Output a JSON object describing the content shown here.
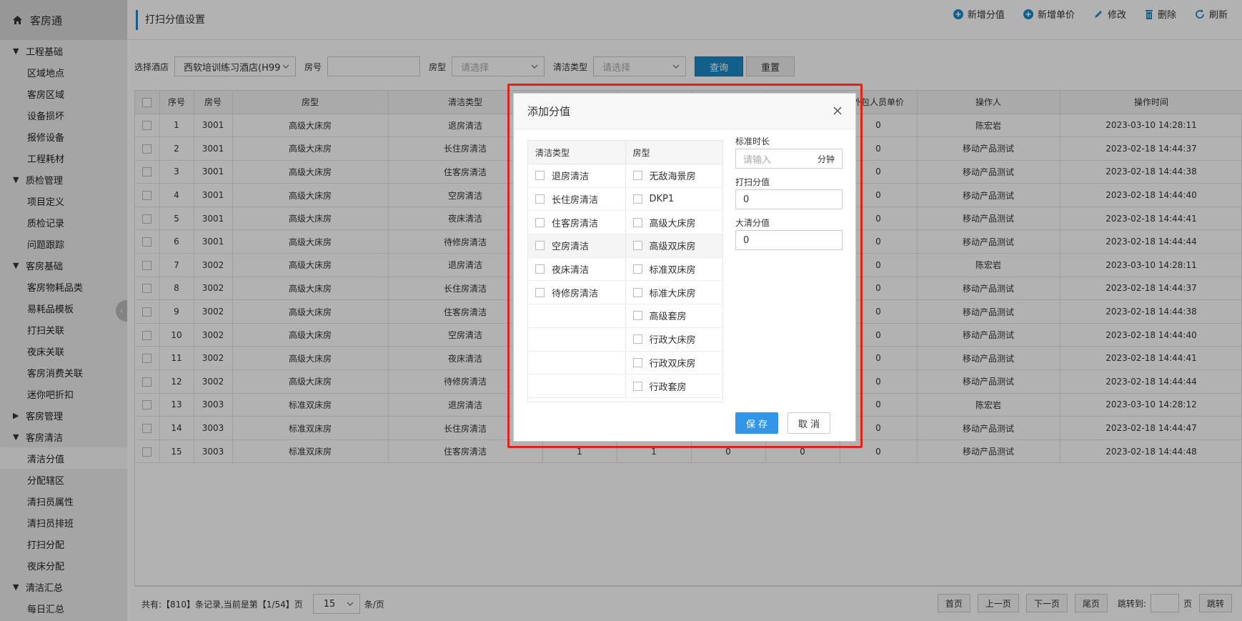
{
  "sidebar": {
    "brand": "客房通",
    "items": [
      {
        "type": "group",
        "label": "工程基础",
        "expanded": true
      },
      {
        "type": "item",
        "label": "区域地点"
      },
      {
        "type": "item",
        "label": "客房区域"
      },
      {
        "type": "item",
        "label": "设备损坏"
      },
      {
        "type": "item",
        "label": "报修设备"
      },
      {
        "type": "item",
        "label": "工程耗材"
      },
      {
        "type": "group",
        "label": "质检管理",
        "expanded": true
      },
      {
        "type": "item",
        "label": "项目定义"
      },
      {
        "type": "item",
        "label": "质检记录"
      },
      {
        "type": "item",
        "label": "问题跟踪"
      },
      {
        "type": "group",
        "label": "客房基础",
        "expanded": true
      },
      {
        "type": "item",
        "label": "客房物耗品类"
      },
      {
        "type": "item",
        "label": "易耗品模板"
      },
      {
        "type": "item",
        "label": "打扫关联"
      },
      {
        "type": "item",
        "label": "夜床关联"
      },
      {
        "type": "item",
        "label": "客房消费关联"
      },
      {
        "type": "item",
        "label": "迷你吧折扣"
      },
      {
        "type": "group",
        "label": "客房管理",
        "expanded": false
      },
      {
        "type": "group",
        "label": "客房清洁",
        "expanded": true
      },
      {
        "type": "item",
        "label": "清洁分值",
        "active": true
      },
      {
        "type": "item",
        "label": "分配辖区"
      },
      {
        "type": "item",
        "label": "清扫员属性"
      },
      {
        "type": "item",
        "label": "清扫员排班"
      },
      {
        "type": "item",
        "label": "打扫分配"
      },
      {
        "type": "item",
        "label": "夜床分配"
      },
      {
        "type": "group",
        "label": "清洁汇总",
        "expanded": true
      },
      {
        "type": "item",
        "label": "每日汇总"
      }
    ]
  },
  "header": {
    "title": "打扫分值设置",
    "toolbar": {
      "add_score": "新增分值",
      "add_price": "新增单价",
      "edit": "修改",
      "delete": "删除",
      "refresh": "刷新"
    }
  },
  "filter": {
    "hotel_label": "选择酒店",
    "hotel_value": "西软培训练习酒店(H99",
    "room_label": "房号",
    "room_type_label": "房型",
    "room_type_placeholder": "请选择",
    "clean_type_label": "清洁类型",
    "clean_type_placeholder": "请选择",
    "query": "查询",
    "reset": "重置"
  },
  "table": {
    "columns": [
      "序号",
      "房号",
      "房型",
      "清洁类型",
      "",
      "",
      "",
      "",
      "外包人员单价",
      "操作人",
      "操作时间"
    ],
    "rows": [
      [
        "1",
        "3001",
        "高级大床房",
        "退房清洁",
        "",
        "",
        "",
        "",
        "0",
        "陈宏岩",
        "2023-03-10 14:28:11"
      ],
      [
        "2",
        "3001",
        "高级大床房",
        "长住房清洁",
        "",
        "",
        "",
        "",
        "0",
        "移动产品测试",
        "2023-02-18 14:44:37"
      ],
      [
        "3",
        "3001",
        "高级大床房",
        "住客房清洁",
        "",
        "",
        "",
        "",
        "0",
        "移动产品测试",
        "2023-02-18 14:44:38"
      ],
      [
        "4",
        "3001",
        "高级大床房",
        "空房清洁",
        "",
        "",
        "",
        "",
        "0",
        "移动产品测试",
        "2023-02-18 14:44:40"
      ],
      [
        "5",
        "3001",
        "高级大床房",
        "夜床清洁",
        "",
        "",
        "",
        "",
        "0",
        "移动产品测试",
        "2023-02-18 14:44:41"
      ],
      [
        "6",
        "3001",
        "高级大床房",
        "待修房清洁",
        "",
        "",
        "",
        "",
        "0",
        "移动产品测试",
        "2023-02-18 14:44:44"
      ],
      [
        "7",
        "3002",
        "高级大床房",
        "退房清洁",
        "",
        "",
        "",
        "",
        "0",
        "陈宏岩",
        "2023-03-10 14:28:11"
      ],
      [
        "8",
        "3002",
        "高级大床房",
        "长住房清洁",
        "",
        "",
        "",
        "",
        "0",
        "移动产品测试",
        "2023-02-18 14:44:37"
      ],
      [
        "9",
        "3002",
        "高级大床房",
        "住客房清洁",
        "",
        "",
        "",
        "",
        "0",
        "移动产品测试",
        "2023-02-18 14:44:38"
      ],
      [
        "10",
        "3002",
        "高级大床房",
        "空房清洁",
        "",
        "",
        "",
        "",
        "0",
        "移动产品测试",
        "2023-02-18 14:44:40"
      ],
      [
        "11",
        "3002",
        "高级大床房",
        "夜床清洁",
        "",
        "",
        "",
        "",
        "0",
        "移动产品测试",
        "2023-02-18 14:44:41"
      ],
      [
        "12",
        "3002",
        "高级大床房",
        "待修房清洁",
        "",
        "",
        "",
        "",
        "0",
        "移动产品测试",
        "2023-02-18 14:44:44"
      ],
      [
        "13",
        "3003",
        "标准双床房",
        "退房清洁",
        "",
        "",
        "",
        "",
        "0",
        "陈宏岩",
        "2023-03-10 14:28:12"
      ],
      [
        "14",
        "3003",
        "标准双床房",
        "长住房清洁",
        "",
        "",
        "",
        "",
        "0",
        "移动产品测试",
        "2023-02-18 14:44:47"
      ],
      [
        "15",
        "3003",
        "标准双床房",
        "住客房清洁",
        "1",
        "1",
        "0",
        "0",
        "0",
        "移动产品测试",
        "2023-02-18 14:44:48"
      ]
    ]
  },
  "pager": {
    "summary": "共有:【810】条记录,当前是第【1/54】页",
    "page_size": "15",
    "per_page_unit": "条/页",
    "first": "首页",
    "prev": "上一页",
    "next": "下一页",
    "last": "尾页",
    "jump_label": "跳转到:",
    "page_unit": "页",
    "jump_button": "跳转"
  },
  "dialog": {
    "title": "添加分值",
    "clean_type_header": "清洁类型",
    "room_type_header": "房型",
    "clean_types": [
      "退房清洁",
      "长住房清洁",
      "住客房清洁",
      "空房清洁",
      "夜床清洁",
      "待修房清洁",
      "",
      "",
      "",
      ""
    ],
    "room_types": [
      "无敌海景房",
      "DKP1",
      "高级大床房",
      "高级双床房",
      "标准双床房",
      "标准大床房",
      "高级套房",
      "行政大床房",
      "行政双床房",
      "行政套房"
    ],
    "highlighted_row": 3,
    "std_duration_label": "标准时长",
    "std_duration_placeholder": "请输入",
    "std_duration_unit": "分钟",
    "clean_score_label": "打扫分值",
    "clean_score_value": "0",
    "deep_score_label": "大清分值",
    "deep_score_value": "0",
    "save": "保 存",
    "cancel": "取 消"
  },
  "colors": {
    "accent": "#1a88c9",
    "save_button": "#3296e8",
    "highlight_border": "#e0241b"
  }
}
